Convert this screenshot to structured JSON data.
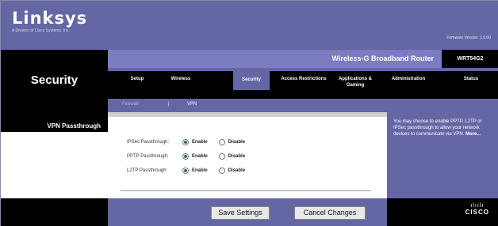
{
  "brand": {
    "logo": "Linksys",
    "tagline": "A Division of Cisco Systems, Inc.",
    "firmware": "Firmware Version: 1.0.00"
  },
  "product": {
    "name": "Wireless-G Broadband Router",
    "model": "WRT54G2"
  },
  "section_title": "Security",
  "tabs": [
    {
      "label": "Setup"
    },
    {
      "label": "Wireless"
    },
    {
      "label": "Security",
      "active": true
    },
    {
      "label": "Access Restrictions"
    },
    {
      "label": "Applications & Gaming"
    },
    {
      "label": "Administration"
    },
    {
      "label": "Status"
    }
  ],
  "subtabs": [
    {
      "label": "Firewall",
      "active": false
    },
    {
      "label": "VPN",
      "active": true
    }
  ],
  "subtab_separator": "|",
  "vpn_section_label": "VPN Passthrough",
  "passthrough": [
    {
      "label": "IPSec Passthrough:",
      "enable": "Enable",
      "disable": "Disable",
      "selected": "enable"
    },
    {
      "label": "PPTP Passthrough:",
      "enable": "Enable",
      "disable": "Disable",
      "selected": "enable"
    },
    {
      "label": "L2TP Passthrough:",
      "enable": "Enable",
      "disable": "Disable",
      "selected": "enable"
    }
  ],
  "help": {
    "text": "You may choose to enable PPTP, L2TP or IPSec passthrough to allow your network devices to communicate via VPN.",
    "more": "More..."
  },
  "buttons": {
    "save": "Save Settings",
    "cancel": "Cancel Changes"
  },
  "footer_logo": {
    "bars": "ılıılı",
    "word": "CISCO"
  },
  "colors": {
    "brand_purple": "#6566a4",
    "product_bar": "#7c7cc0",
    "radio_checked": "#2b7a2b"
  }
}
